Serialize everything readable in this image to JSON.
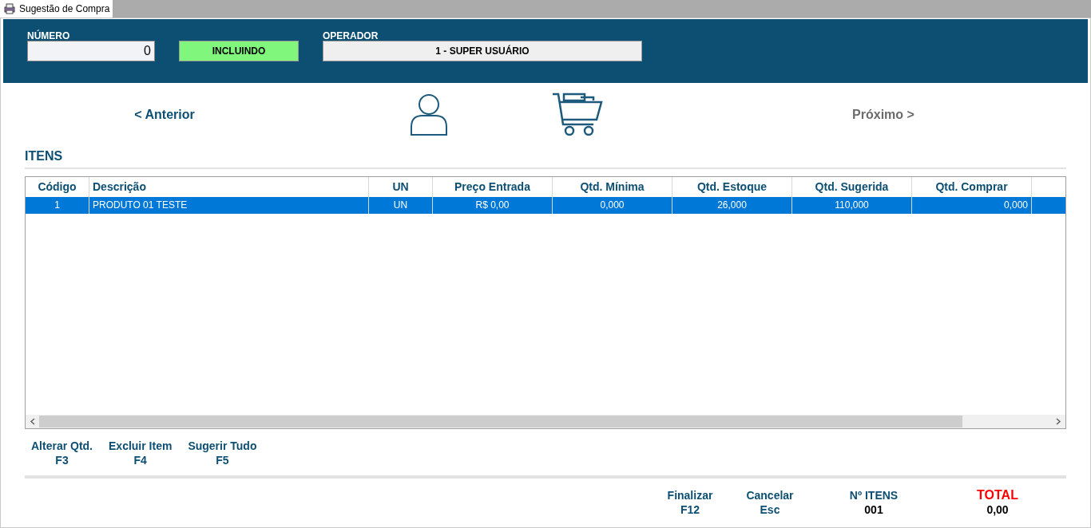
{
  "tab": {
    "title": "Sugestão de Compra",
    "selected": true
  },
  "header": {
    "numero_label": "NÚMERO",
    "numero": "0",
    "status": "INCLUINDO",
    "operador_label": "OPERADOR",
    "operador": "1 - SUPER USUÁRIO"
  },
  "nav": {
    "previous": {
      "label": "< Anterior",
      "disabled": false
    },
    "next": {
      "label": "Próximo >",
      "disabled": true
    }
  },
  "section_title": "ITENS",
  "table": {
    "columns": [
      "Código",
      "Descrição",
      "UN",
      "Preço Entrada",
      "Qtd. Mínima",
      "Qtd. Estoque",
      "Qtd. Sugerida",
      "Qtd. Comprar"
    ],
    "rows": [
      {
        "selected": true,
        "cells": [
          "1",
          "PRODUTO 01 TESTE",
          "UN",
          "R$ 0,00",
          "0,000",
          "26,000",
          "110,000",
          "0,000"
        ]
      }
    ]
  },
  "actions": [
    {
      "label": "Alterar Qtd.",
      "key": "F3"
    },
    {
      "label": "Excluir Item",
      "key": "F4"
    },
    {
      "label": "Sugerir Tudo",
      "key": "F5"
    }
  ],
  "footer": {
    "buttons": [
      {
        "label": "Finalizar",
        "key": "F12"
      },
      {
        "label": "Cancelar",
        "key": "Esc"
      }
    ],
    "items_label": "Nº ITENS",
    "items_value": "001",
    "total_label": "TOTAL",
    "total_value": "0,00"
  }
}
